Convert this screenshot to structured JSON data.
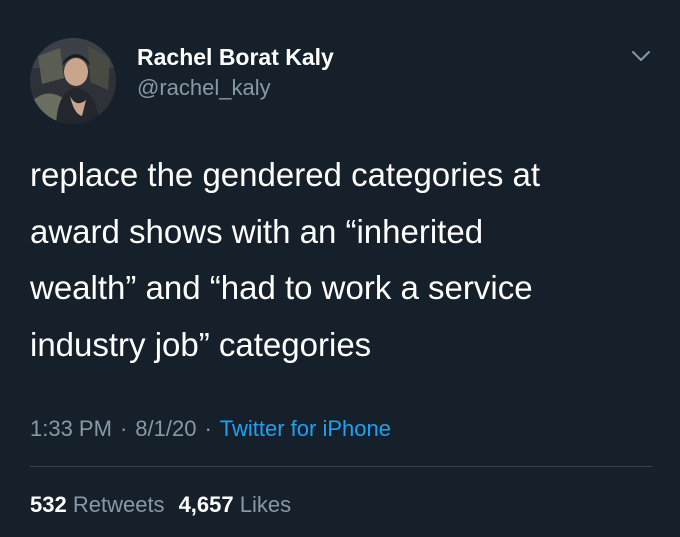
{
  "author": {
    "name": "Rachel Borat Kaly",
    "handle": "@rachel_kaly"
  },
  "tweet": {
    "lines": [
      "replace the gendered categories at",
      "award shows with an “inherited",
      "wealth” and “had to work a service",
      "industry job” categories"
    ]
  },
  "meta": {
    "time": "1:33 PM",
    "separator": "·",
    "date": "8/1/20",
    "source": "Twitter for iPhone"
  },
  "stats": {
    "retweets_count": "532",
    "retweets_label": "Retweets",
    "likes_count": "4,657",
    "likes_label": "Likes"
  },
  "icons": {
    "more": "chevron-down-icon"
  },
  "colors": {
    "background": "#15202b",
    "text_primary": "#ffffff",
    "text_secondary": "#8899a6",
    "link": "#1da1f2",
    "divider": "#38444d"
  }
}
